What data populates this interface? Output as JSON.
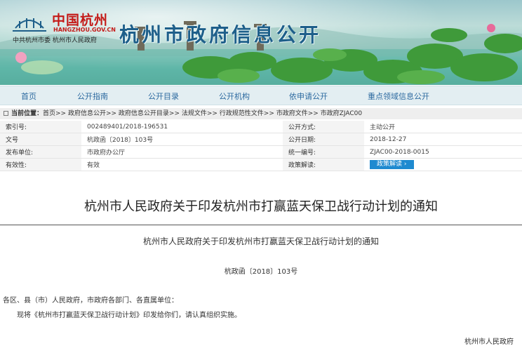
{
  "header": {
    "logo_cn": "中国杭州",
    "logo_en": "HANGZHOU.GOV.CN",
    "logo_sub": "中共杭州市委   杭州市人民政府",
    "banner_title": "杭州市政府信息公开"
  },
  "nav": {
    "items": [
      "首页",
      "公开指南",
      "公开目录",
      "公开机构",
      "依申请公开",
      "重点领域信息公开"
    ]
  },
  "breadcrumb": {
    "label": "当前位置：",
    "path": "首页>> 政府信息公开>> 政府信息公开目录>> 法规文件>> 行政规范性文件>> 市政府文件>> 市政府ZJAC00"
  },
  "info": {
    "r1": {
      "l1": "索引号:",
      "v1": "002489401/2018-196531",
      "l2": "公开方式:",
      "v2": "主动公开"
    },
    "r2": {
      "l1": "文号",
      "v1": "杭政函〔2018〕103号",
      "l2": "公开日期:",
      "v2": "2018-12-27"
    },
    "r3": {
      "l1": "发布单位:",
      "v1": "市政府办公厅",
      "l2": "统一编号:",
      "v2": "ZJAC00-2018-0015"
    },
    "r4": {
      "l1": "有效性:",
      "v1": "有效",
      "l2": "政策解读:",
      "button": "政策解读"
    },
    "button_arrow": "›"
  },
  "doc": {
    "title": "杭州市人民政府关于印发杭州市打赢蓝天保卫战行动计划的通知",
    "subtitle": "杭州市人民政府关于印发杭州市打赢蓝天保卫战行动计划的通知",
    "doc_no": "杭政函〔2018〕103号",
    "address": "各区、县（市）人民政府，市政府各部门、各直属单位：",
    "body": "现将《杭州市打赢蓝天保卫战行动计划》印发给你们，请认真组织实施。",
    "signature": "杭州市人民政府"
  }
}
